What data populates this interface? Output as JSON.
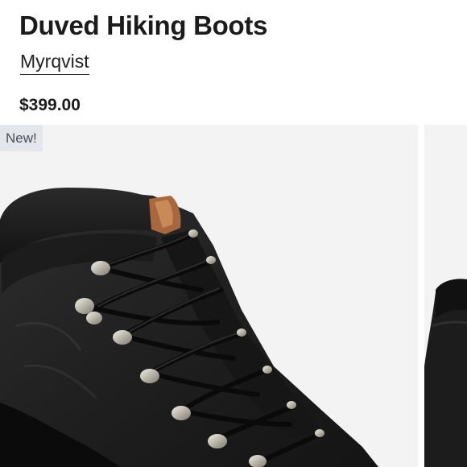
{
  "product": {
    "title": "Duved Hiking Boots",
    "brand": "Myrqvist",
    "price": "$399.00",
    "badge": "New!"
  },
  "images": [
    {
      "name": "main-photo",
      "subject": "black suede hiking boot with black laces and silver hooks"
    },
    {
      "name": "next-photo",
      "subject": "black hiking boot, partially visible"
    }
  ],
  "colors": {
    "text": "#1b1b1b",
    "badge_bg": "#e3e6ea",
    "badge_text": "#4a4f56",
    "photo_bg": "#f3f3f3"
  }
}
